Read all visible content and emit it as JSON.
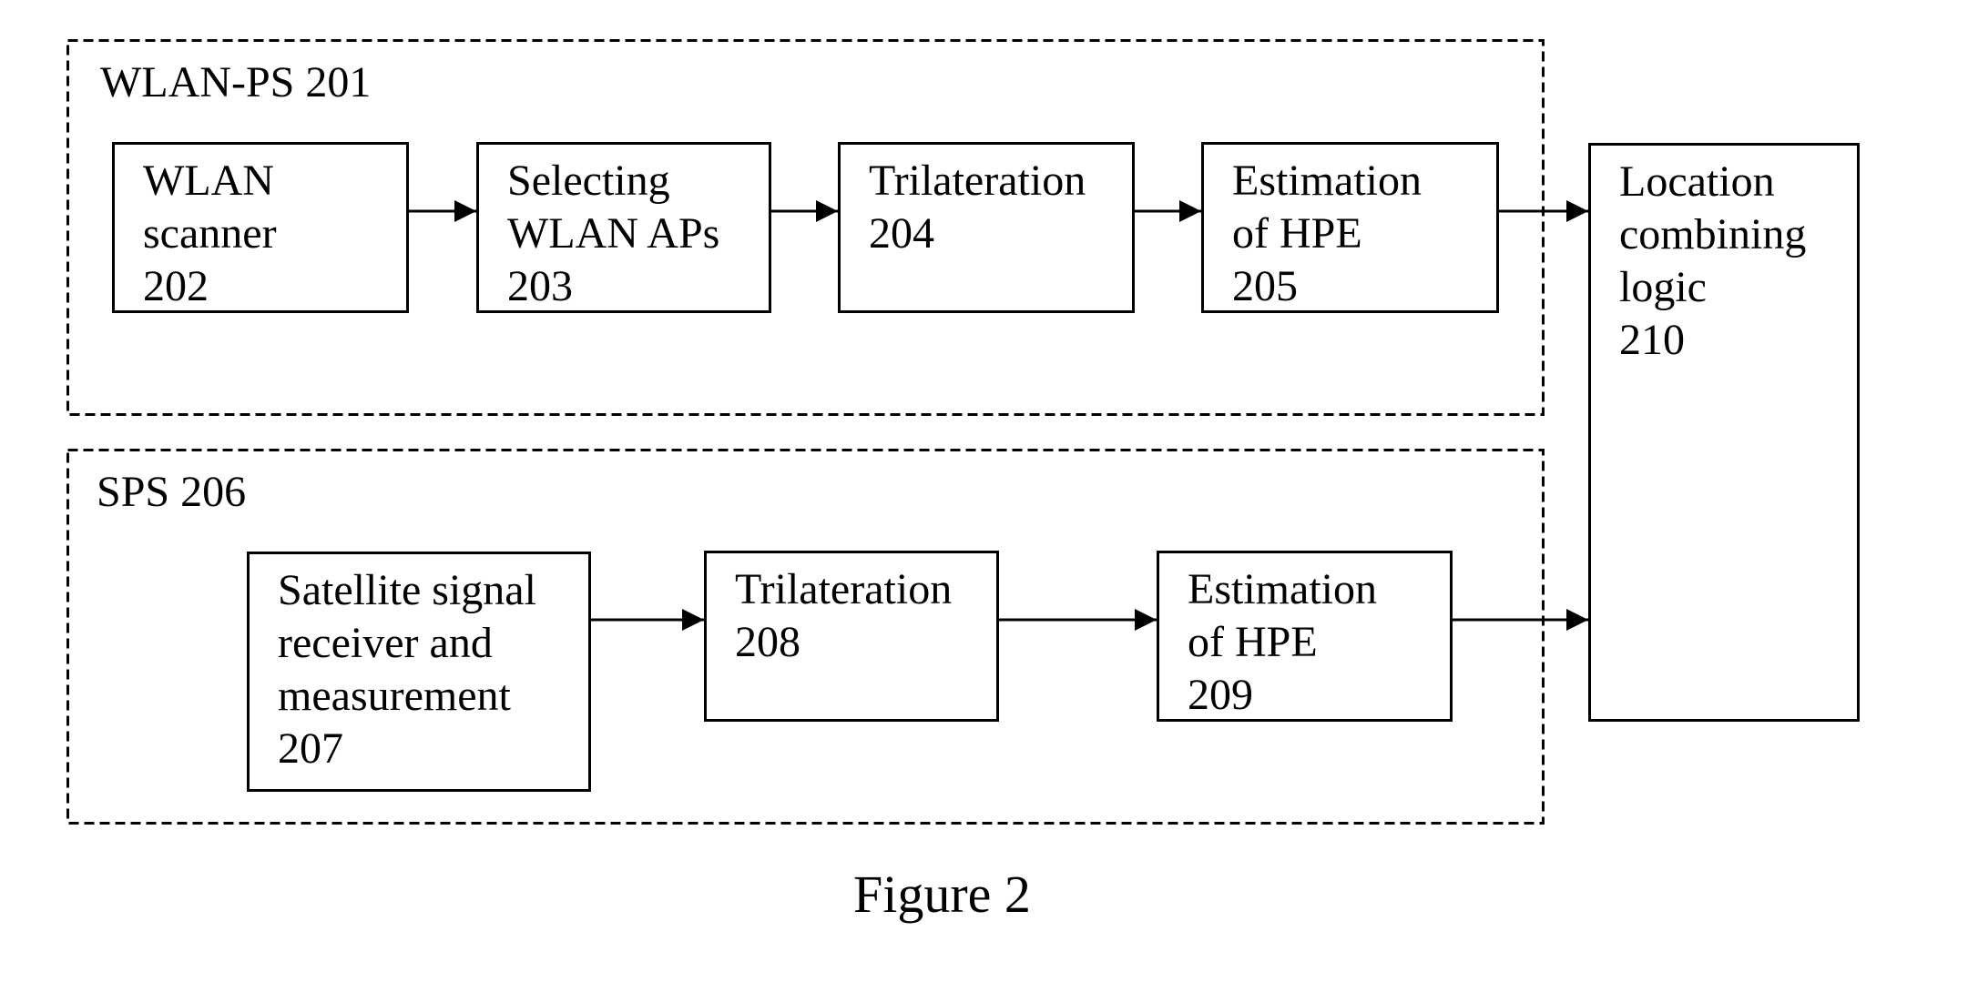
{
  "figure": {
    "caption": "Figure 2"
  },
  "groups": {
    "wlan_ps": {
      "label": "WLAN-PS 201"
    },
    "sps": {
      "label": "SPS 206"
    }
  },
  "blocks": {
    "b202": {
      "lines": [
        "WLAN",
        "scanner",
        "202"
      ]
    },
    "b203": {
      "lines": [
        "Selecting",
        "WLAN APs",
        "203"
      ]
    },
    "b204": {
      "lines": [
        "Trilateration",
        "204"
      ]
    },
    "b205": {
      "lines": [
        "Estimation",
        "of HPE",
        "205"
      ]
    },
    "b207": {
      "lines": [
        "Satellite signal",
        "receiver and",
        "measurement",
        "207"
      ]
    },
    "b208": {
      "lines": [
        "Trilateration",
        "208"
      ]
    },
    "b209": {
      "lines": [
        "Estimation",
        "of HPE",
        "209"
      ]
    },
    "b210": {
      "lines": [
        "Location",
        "combining",
        "logic",
        "210"
      ]
    }
  },
  "connections": [
    {
      "from": "202",
      "to": "203"
    },
    {
      "from": "203",
      "to": "204"
    },
    {
      "from": "204",
      "to": "205"
    },
    {
      "from": "205",
      "to": "210"
    },
    {
      "from": "207",
      "to": "208"
    },
    {
      "from": "208",
      "to": "209"
    },
    {
      "from": "209",
      "to": "210"
    }
  ],
  "colors": {
    "line": "#000000",
    "background": "#ffffff"
  }
}
